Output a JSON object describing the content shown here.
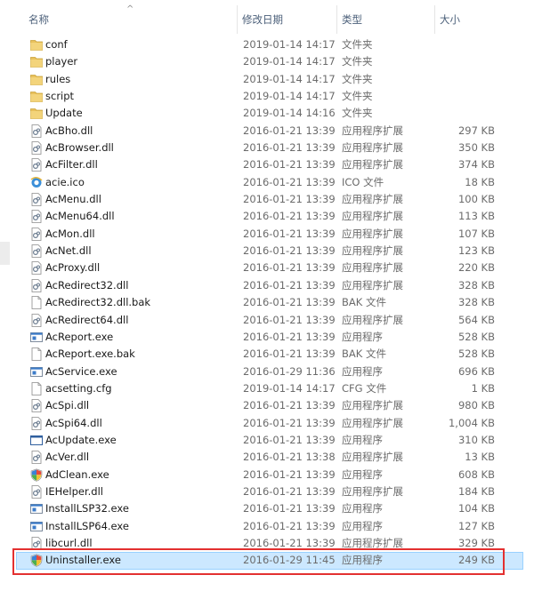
{
  "columns": {
    "name": "名称",
    "date": "修改日期",
    "type": "类型",
    "size": "大小"
  },
  "sort_indicator": "^",
  "files": [
    {
      "name": "conf",
      "date": "2019-01-14 14:17",
      "type": "文件夹",
      "size": "",
      "icon": "folder-icon"
    },
    {
      "name": "player",
      "date": "2019-01-14 14:17",
      "type": "文件夹",
      "size": "",
      "icon": "folder-icon"
    },
    {
      "name": "rules",
      "date": "2019-01-14 14:17",
      "type": "文件夹",
      "size": "",
      "icon": "folder-icon"
    },
    {
      "name": "script",
      "date": "2019-01-14 14:17",
      "type": "文件夹",
      "size": "",
      "icon": "folder-icon"
    },
    {
      "name": "Update",
      "date": "2019-01-14 14:16",
      "type": "文件夹",
      "size": "",
      "icon": "folder-icon"
    },
    {
      "name": "AcBho.dll",
      "date": "2016-01-21 13:39",
      "type": "应用程序扩展",
      "size": "297 KB",
      "icon": "dll-icon"
    },
    {
      "name": "AcBrowser.dll",
      "date": "2016-01-21 13:39",
      "type": "应用程序扩展",
      "size": "350 KB",
      "icon": "dll-icon"
    },
    {
      "name": "AcFilter.dll",
      "date": "2016-01-21 13:39",
      "type": "应用程序扩展",
      "size": "374 KB",
      "icon": "dll-icon"
    },
    {
      "name": "acie.ico",
      "date": "2016-01-21 13:39",
      "type": "ICO 文件",
      "size": "18 KB",
      "icon": "ie-icon"
    },
    {
      "name": "AcMenu.dll",
      "date": "2016-01-21 13:39",
      "type": "应用程序扩展",
      "size": "100 KB",
      "icon": "dll-icon"
    },
    {
      "name": "AcMenu64.dll",
      "date": "2016-01-21 13:39",
      "type": "应用程序扩展",
      "size": "113 KB",
      "icon": "dll-icon"
    },
    {
      "name": "AcMon.dll",
      "date": "2016-01-21 13:39",
      "type": "应用程序扩展",
      "size": "107 KB",
      "icon": "dll-icon"
    },
    {
      "name": "AcNet.dll",
      "date": "2016-01-21 13:39",
      "type": "应用程序扩展",
      "size": "123 KB",
      "icon": "dll-icon"
    },
    {
      "name": "AcProxy.dll",
      "date": "2016-01-21 13:39",
      "type": "应用程序扩展",
      "size": "220 KB",
      "icon": "dll-icon"
    },
    {
      "name": "AcRedirect32.dll",
      "date": "2016-01-21 13:39",
      "type": "应用程序扩展",
      "size": "328 KB",
      "icon": "dll-icon"
    },
    {
      "name": "AcRedirect32.dll.bak",
      "date": "2016-01-21 13:39",
      "type": "BAK 文件",
      "size": "328 KB",
      "icon": "file-icon"
    },
    {
      "name": "AcRedirect64.dll",
      "date": "2016-01-21 13:39",
      "type": "应用程序扩展",
      "size": "564 KB",
      "icon": "dll-icon"
    },
    {
      "name": "AcReport.exe",
      "date": "2016-01-21 13:39",
      "type": "应用程序",
      "size": "528 KB",
      "icon": "exe-icon"
    },
    {
      "name": "AcReport.exe.bak",
      "date": "2016-01-21 13:39",
      "type": "BAK 文件",
      "size": "528 KB",
      "icon": "file-icon"
    },
    {
      "name": "AcService.exe",
      "date": "2016-01-29 11:36",
      "type": "应用程序",
      "size": "696 KB",
      "icon": "exe-icon"
    },
    {
      "name": "acsetting.cfg",
      "date": "2019-01-14 14:17",
      "type": "CFG 文件",
      "size": "1 KB",
      "icon": "file-icon"
    },
    {
      "name": "AcSpi.dll",
      "date": "2016-01-21 13:39",
      "type": "应用程序扩展",
      "size": "980 KB",
      "icon": "dll-icon"
    },
    {
      "name": "AcSpi64.dll",
      "date": "2016-01-21 13:39",
      "type": "应用程序扩展",
      "size": "1,004 KB",
      "icon": "dll-icon"
    },
    {
      "name": "AcUpdate.exe",
      "date": "2016-01-21 13:39",
      "type": "应用程序",
      "size": "310 KB",
      "icon": "window-exe-icon"
    },
    {
      "name": "AcVer.dll",
      "date": "2016-01-21 13:38",
      "type": "应用程序扩展",
      "size": "13 KB",
      "icon": "dll-icon"
    },
    {
      "name": "AdClean.exe",
      "date": "2016-01-21 13:39",
      "type": "应用程序",
      "size": "608 KB",
      "icon": "shield-icon"
    },
    {
      "name": "IEHelper.dll",
      "date": "2016-01-21 13:39",
      "type": "应用程序扩展",
      "size": "184 KB",
      "icon": "dll-icon"
    },
    {
      "name": "InstallLSP32.exe",
      "date": "2016-01-21 13:39",
      "type": "应用程序",
      "size": "104 KB",
      "icon": "exe-icon"
    },
    {
      "name": "InstallLSP64.exe",
      "date": "2016-01-21 13:39",
      "type": "应用程序",
      "size": "127 KB",
      "icon": "exe-icon"
    },
    {
      "name": "libcurl.dll",
      "date": "2016-01-21 13:39",
      "type": "应用程序扩展",
      "size": "329 KB",
      "icon": "dll-icon"
    },
    {
      "name": "Uninstaller.exe",
      "date": "2016-01-29 11:45",
      "type": "应用程序",
      "size": "249 KB",
      "icon": "shield-icon",
      "selected": true
    }
  ],
  "colors": {
    "header_text": "#4c607a",
    "selection_bg": "#cce8ff",
    "selection_border": "#99d1ff",
    "highlight_box": "#e33030",
    "folder": "#e8c15c"
  }
}
